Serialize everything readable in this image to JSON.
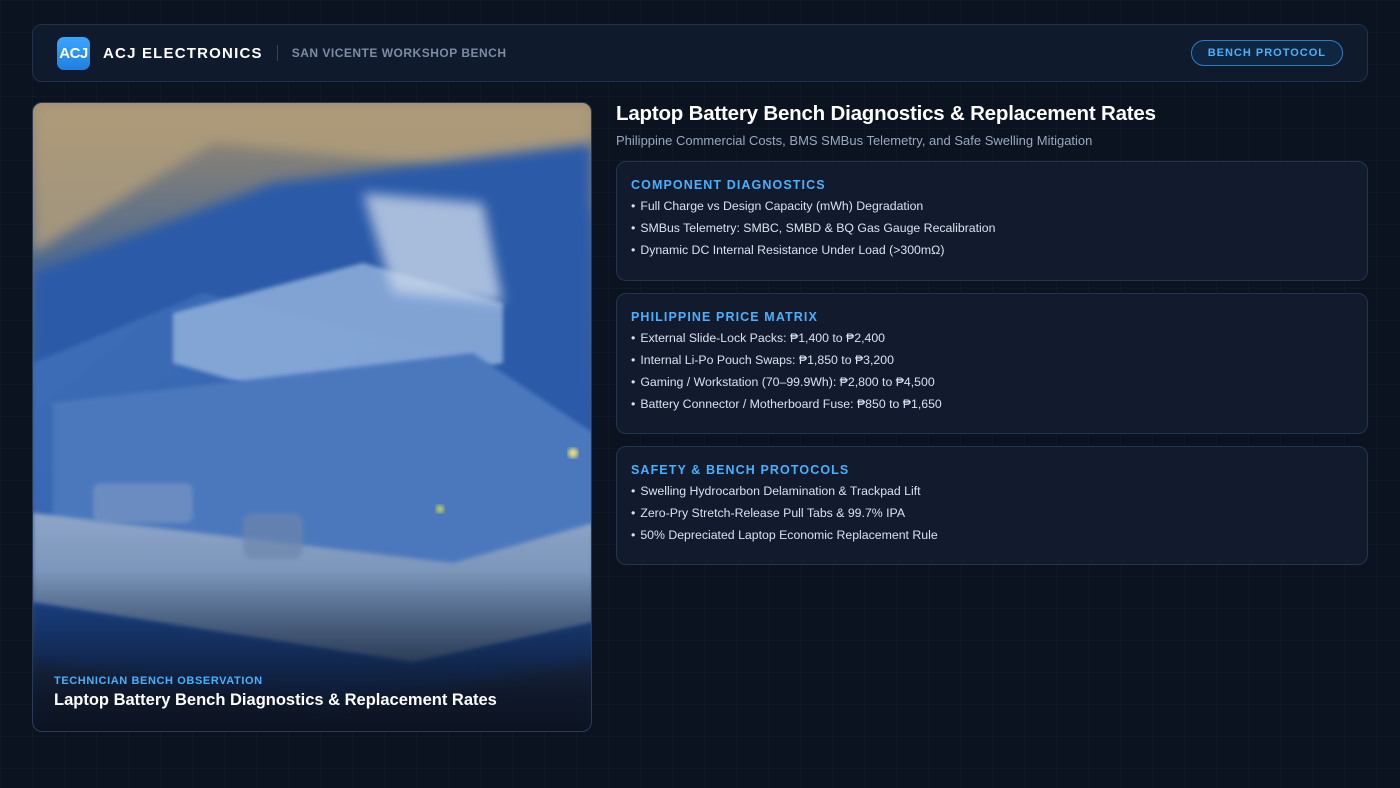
{
  "header": {
    "logo_text": "ACJ",
    "brand": "ACJ ELECTRONICS",
    "location": "SAN VICENTE WORKSHOP BENCH",
    "badge": "BENCH PROTOCOL"
  },
  "photo": {
    "tag": "TECHNICIAN BENCH OBSERVATION",
    "caption": "Laptop Battery Bench Diagnostics & Replacement Rates"
  },
  "main": {
    "title": "Laptop Battery Bench Diagnostics & Replacement Rates",
    "subtitle": "Philippine Commercial Costs, BMS SMBus Telemetry, and Safe Swelling Mitigation",
    "cards": [
      {
        "heading": "COMPONENT DIAGNOSTICS",
        "items": [
          "Full Charge vs Design Capacity (mWh) Degradation",
          "SMBus Telemetry: SMBC, SMBD & BQ Gas Gauge Recalibration",
          "Dynamic DC Internal Resistance Under Load (>300mΩ)"
        ]
      },
      {
        "heading": "PHILIPPINE PRICE MATRIX",
        "items": [
          "External Slide-Lock Packs: ₱1,400 to ₱2,400",
          "Internal Li-Po Pouch Swaps: ₱1,850 to ₱3,200",
          "Gaming / Workstation (70–99.9Wh): ₱2,800 to ₱4,500",
          "Battery Connector / Motherboard Fuse: ₱850 to ₱1,650"
        ]
      },
      {
        "heading": "SAFETY & BENCH PROTOCOLS",
        "items": [
          "Swelling Hydrocarbon Delamination & Trackpad Lift",
          "Zero-Pry Stretch-Release Pull Tabs & 99.7% IPA",
          "50% Depreciated Laptop Economic Replacement Rule"
        ]
      }
    ]
  },
  "colors": {
    "accent": "#48b1ff",
    "background": "#0b1220",
    "card": "#111b2d"
  }
}
